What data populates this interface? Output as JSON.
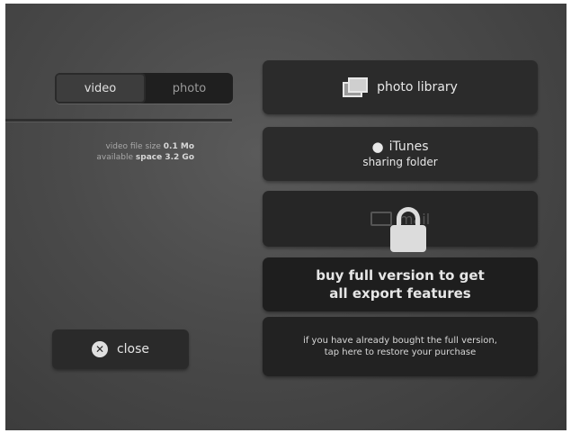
{
  "mode_toggle": {
    "video_label": "video",
    "photo_label": "photo"
  },
  "file_info": {
    "size_label": "video file size",
    "size_value": "0.1 Mo",
    "space_label": "available",
    "space_value": "space 3.2 Go"
  },
  "close_button": {
    "label": "close"
  },
  "export": {
    "photo_library_label": "photo library",
    "itunes_label": "iTunes",
    "itunes_sub": "sharing folder",
    "mail_label": "mail",
    "upgrade_line1": "buy full version to get",
    "upgrade_line2": "all export features",
    "restore_line1": "if you have already bought the full version,",
    "restore_line2": "tap here to restore your purchase"
  }
}
